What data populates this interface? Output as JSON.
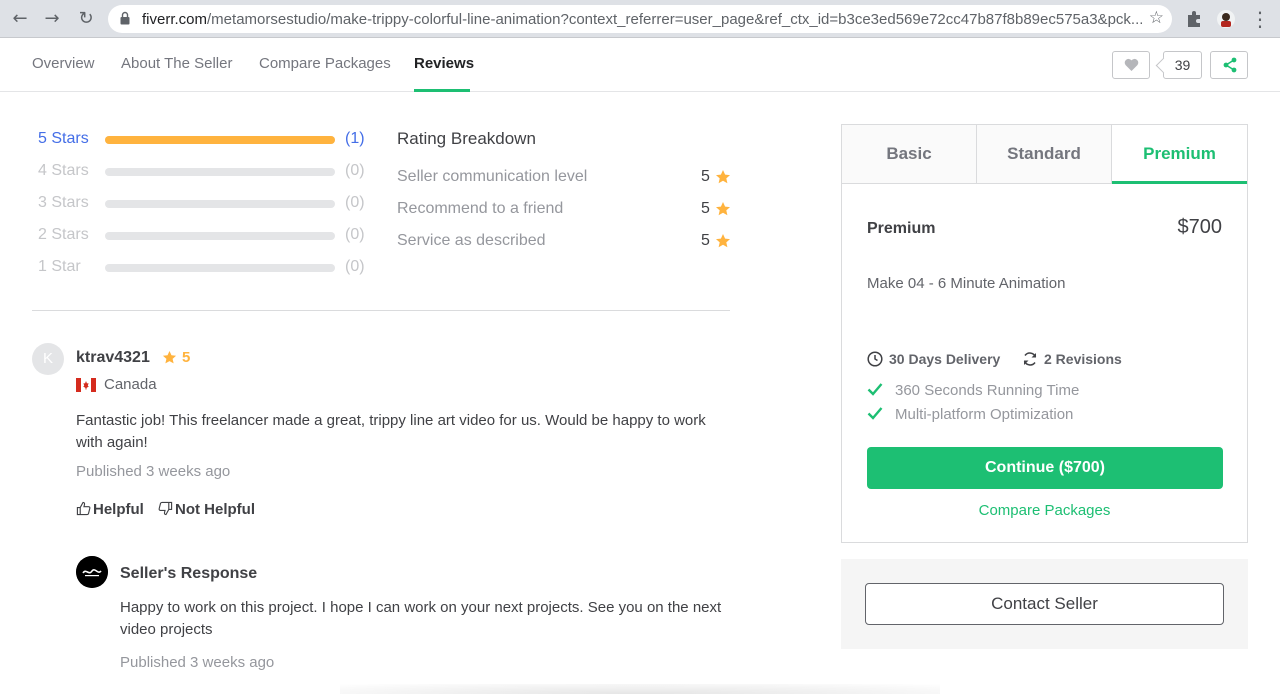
{
  "browser": {
    "url_domain": "fiverr.com",
    "url_path": "/metamorsestudio/make-trippy-colorful-line-animation?context_referrer=user_page&ref_ctx_id=b3ce3ed569e72cc47b87f8b89ec575a3&pck..."
  },
  "nav": {
    "tabs": [
      {
        "label": "Overview"
      },
      {
        "label": "About The Seller"
      },
      {
        "label": "Compare Packages"
      },
      {
        "label": "Reviews"
      }
    ],
    "active_tab": "Reviews",
    "likes_count": "39"
  },
  "star_breakdown": [
    {
      "label": "5 Stars",
      "count": "(1)",
      "fraction": 1.0
    },
    {
      "label": "4 Stars",
      "count": "(0)",
      "fraction": 0
    },
    {
      "label": "3 Stars",
      "count": "(0)",
      "fraction": 0
    },
    {
      "label": "2 Stars",
      "count": "(0)",
      "fraction": 0
    },
    {
      "label": "1 Star",
      "count": "(0)",
      "fraction": 0
    }
  ],
  "rating_breakdown": {
    "title": "Rating Breakdown",
    "items": [
      {
        "label": "Seller communication level",
        "score": "5"
      },
      {
        "label": "Recommend to a friend",
        "score": "5"
      },
      {
        "label": "Service as described",
        "score": "5"
      }
    ]
  },
  "review": {
    "avatar_letter": "K",
    "username": "ktrav4321",
    "rating": "5",
    "country": "Canada",
    "text": "Fantastic job! This freelancer made a great, trippy line art video for us. Would be happy to work with again!",
    "published": "Published 3 weeks ago",
    "helpful_label": "Helpful",
    "not_helpful_label": "Not Helpful",
    "seller_response": {
      "title": "Seller's Response",
      "text": "Happy to work on this project. I hope I can work on your next projects. See you on the next video projects",
      "published": "Published 3 weeks ago"
    }
  },
  "package": {
    "tabs": [
      {
        "label": "Basic"
      },
      {
        "label": "Standard"
      },
      {
        "label": "Premium"
      }
    ],
    "active_tab": "Premium",
    "name": "Premium",
    "price": "$700",
    "description": "Make 04 - 6 Minute Animation",
    "delivery": "30 Days Delivery",
    "revisions": "2 Revisions",
    "features": [
      "360 Seconds Running Time",
      "Multi-platform Optimization"
    ],
    "continue_label": "Continue ($700)",
    "compare_label": "Compare Packages",
    "contact_label": "Contact Seller"
  },
  "colors": {
    "accent_green": "#1dbf73",
    "star_orange": "#ffb33e",
    "link_blue": "#446ee7"
  }
}
